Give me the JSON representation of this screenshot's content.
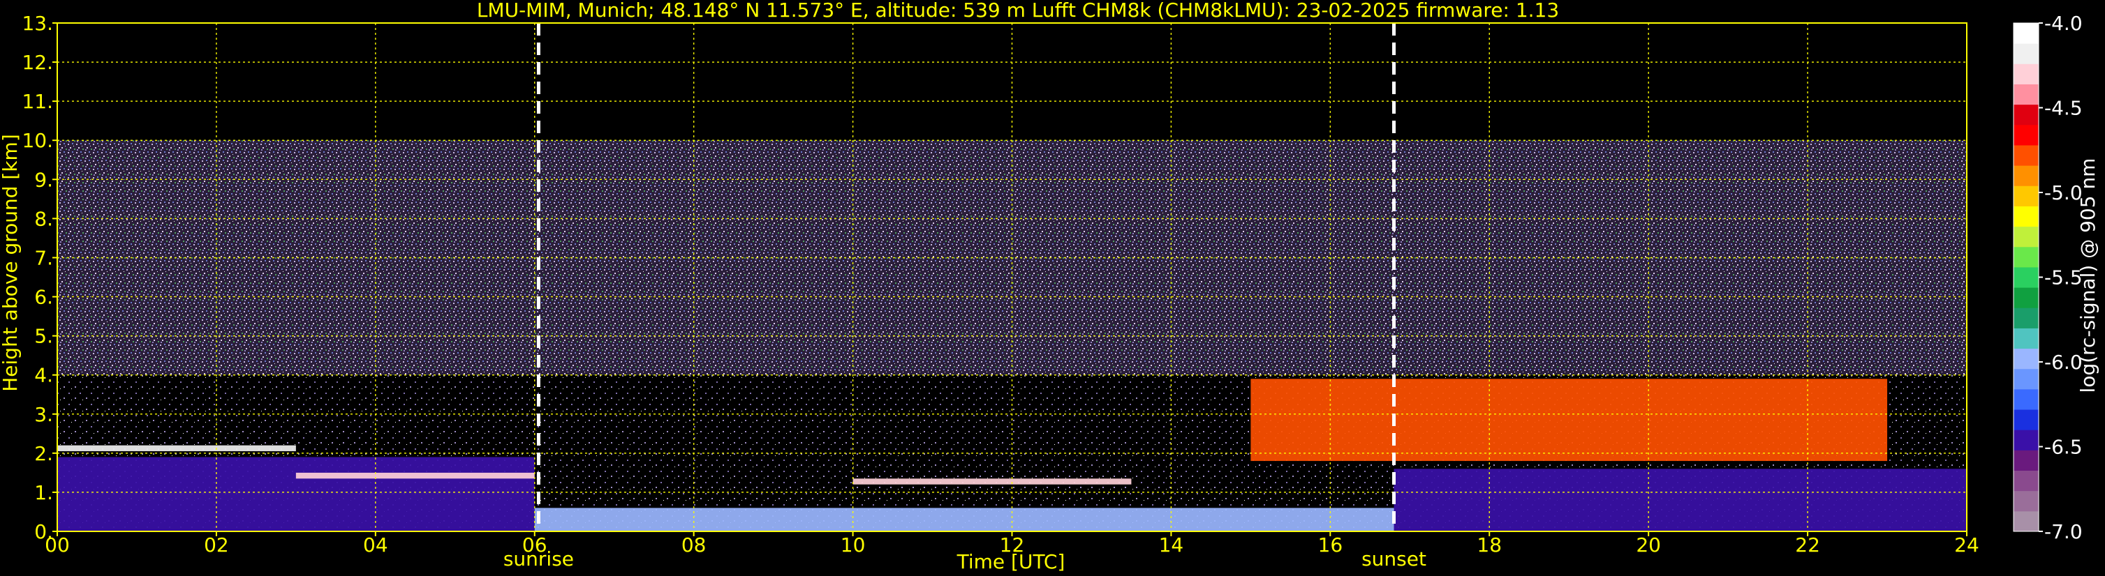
{
  "chart_data": {
    "type": "heatmap",
    "title": "LMU-MIM, Munich; 48.148° N 11.573° E, altitude: 539 m    Lufft CHM8k (CHM8kLMU): 23-02-2025    firmware: 1.13",
    "xlabel": "Time [UTC]",
    "ylabel": "Height above ground [km]",
    "xlim": [
      0,
      24
    ],
    "ylim": [
      0,
      13
    ],
    "x_ticks": [
      "00",
      "02",
      "04",
      "06",
      "08",
      "10",
      "12",
      "14",
      "16",
      "18",
      "20",
      "22",
      "24"
    ],
    "x_tick_values": [
      0,
      2,
      4,
      6,
      8,
      10,
      12,
      14,
      16,
      18,
      20,
      22,
      24
    ],
    "y_ticks": [
      "0.",
      "1.",
      "2.",
      "3.",
      "4.",
      "5.",
      "6.",
      "7.",
      "8.",
      "9.",
      "10.",
      "11.",
      "12.",
      "13."
    ],
    "y_tick_values": [
      0,
      1,
      2,
      3,
      4,
      5,
      6,
      7,
      8,
      9,
      10,
      11,
      12,
      13
    ],
    "grid": true,
    "grid_color": "#ffff00",
    "data_top_km": 10,
    "markers": [
      {
        "label": "sunrise",
        "x": 6.05
      },
      {
        "label": "sunset",
        "x": 16.8
      }
    ],
    "colorbar": {
      "label": "log(rc-signal) @ 905 nm",
      "ticks": [
        "-4.0",
        "-4.5",
        "-5.0",
        "-5.5",
        "-6.0",
        "-6.5",
        "-7.0"
      ],
      "tick_values": [
        -4.0,
        -4.5,
        -5.0,
        -5.5,
        -6.0,
        -6.5,
        -7.0
      ],
      "range": [
        -7.0,
        -4.0
      ],
      "colors": [
        "#a890a8",
        "#9a6e9a",
        "#8a4a8e",
        "#6a1a7e",
        "#3a10a8",
        "#1a30e0",
        "#3a6aff",
        "#6a96ff",
        "#9ab6ff",
        "#50c4c0",
        "#1a9e6a",
        "#10a040",
        "#2ad060",
        "#6ae84a",
        "#c0f03a",
        "#ffff00",
        "#ffc800",
        "#ff9000",
        "#ff5000",
        "#ff0000",
        "#e00010",
        "#ff90a0",
        "#ffd0d8",
        "#f0f0f0",
        "#ffffff"
      ]
    },
    "layers": [
      {
        "name": "boundary-layer-aerosol",
        "segments": [
          {
            "t0": 0.0,
            "t1": 6.0,
            "h0": 0.0,
            "h1": 1.9,
            "value": -6.4
          },
          {
            "t0": 6.0,
            "t1": 16.8,
            "h0": 0.0,
            "h1": 0.6,
            "value": -6.0
          },
          {
            "t0": 16.8,
            "t1": 24.0,
            "h0": 0.0,
            "h1": 1.6,
            "value": -6.4
          }
        ]
      },
      {
        "name": "cloud-base-layer",
        "segments": [
          {
            "t0": 0.0,
            "t1": 3.0,
            "h0": 2.05,
            "h1": 2.2,
            "value": -4.2
          },
          {
            "t0": 3.0,
            "t1": 6.0,
            "h0": 1.35,
            "h1": 1.5,
            "value": -4.3
          },
          {
            "t0": 10.0,
            "t1": 13.5,
            "h0": 1.2,
            "h1": 1.35,
            "value": -4.3
          },
          {
            "t0": 15.0,
            "t1": 23.0,
            "h0": 1.8,
            "h1": 3.9,
            "value": -4.8
          }
        ]
      }
    ]
  }
}
